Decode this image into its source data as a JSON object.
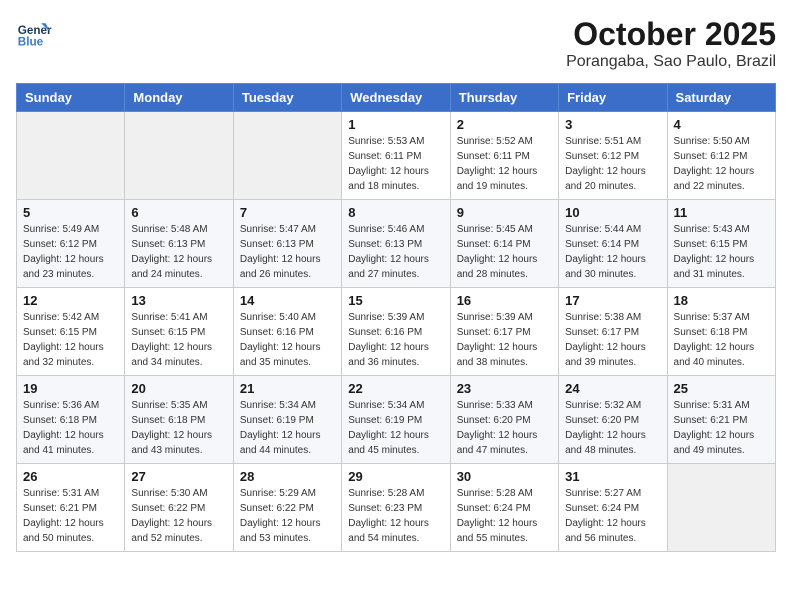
{
  "logo": {
    "line1": "General",
    "line2": "Blue"
  },
  "title": "October 2025",
  "subtitle": "Porangaba, Sao Paulo, Brazil",
  "days_of_week": [
    "Sunday",
    "Monday",
    "Tuesday",
    "Wednesday",
    "Thursday",
    "Friday",
    "Saturday"
  ],
  "weeks": [
    [
      {
        "num": "",
        "info": ""
      },
      {
        "num": "",
        "info": ""
      },
      {
        "num": "",
        "info": ""
      },
      {
        "num": "1",
        "info": "Sunrise: 5:53 AM\nSunset: 6:11 PM\nDaylight: 12 hours and 18 minutes."
      },
      {
        "num": "2",
        "info": "Sunrise: 5:52 AM\nSunset: 6:11 PM\nDaylight: 12 hours and 19 minutes."
      },
      {
        "num": "3",
        "info": "Sunrise: 5:51 AM\nSunset: 6:12 PM\nDaylight: 12 hours and 20 minutes."
      },
      {
        "num": "4",
        "info": "Sunrise: 5:50 AM\nSunset: 6:12 PM\nDaylight: 12 hours and 22 minutes."
      }
    ],
    [
      {
        "num": "5",
        "info": "Sunrise: 5:49 AM\nSunset: 6:12 PM\nDaylight: 12 hours and 23 minutes."
      },
      {
        "num": "6",
        "info": "Sunrise: 5:48 AM\nSunset: 6:13 PM\nDaylight: 12 hours and 24 minutes."
      },
      {
        "num": "7",
        "info": "Sunrise: 5:47 AM\nSunset: 6:13 PM\nDaylight: 12 hours and 26 minutes."
      },
      {
        "num": "8",
        "info": "Sunrise: 5:46 AM\nSunset: 6:13 PM\nDaylight: 12 hours and 27 minutes."
      },
      {
        "num": "9",
        "info": "Sunrise: 5:45 AM\nSunset: 6:14 PM\nDaylight: 12 hours and 28 minutes."
      },
      {
        "num": "10",
        "info": "Sunrise: 5:44 AM\nSunset: 6:14 PM\nDaylight: 12 hours and 30 minutes."
      },
      {
        "num": "11",
        "info": "Sunrise: 5:43 AM\nSunset: 6:15 PM\nDaylight: 12 hours and 31 minutes."
      }
    ],
    [
      {
        "num": "12",
        "info": "Sunrise: 5:42 AM\nSunset: 6:15 PM\nDaylight: 12 hours and 32 minutes."
      },
      {
        "num": "13",
        "info": "Sunrise: 5:41 AM\nSunset: 6:15 PM\nDaylight: 12 hours and 34 minutes."
      },
      {
        "num": "14",
        "info": "Sunrise: 5:40 AM\nSunset: 6:16 PM\nDaylight: 12 hours and 35 minutes."
      },
      {
        "num": "15",
        "info": "Sunrise: 5:39 AM\nSunset: 6:16 PM\nDaylight: 12 hours and 36 minutes."
      },
      {
        "num": "16",
        "info": "Sunrise: 5:39 AM\nSunset: 6:17 PM\nDaylight: 12 hours and 38 minutes."
      },
      {
        "num": "17",
        "info": "Sunrise: 5:38 AM\nSunset: 6:17 PM\nDaylight: 12 hours and 39 minutes."
      },
      {
        "num": "18",
        "info": "Sunrise: 5:37 AM\nSunset: 6:18 PM\nDaylight: 12 hours and 40 minutes."
      }
    ],
    [
      {
        "num": "19",
        "info": "Sunrise: 5:36 AM\nSunset: 6:18 PM\nDaylight: 12 hours and 41 minutes."
      },
      {
        "num": "20",
        "info": "Sunrise: 5:35 AM\nSunset: 6:18 PM\nDaylight: 12 hours and 43 minutes."
      },
      {
        "num": "21",
        "info": "Sunrise: 5:34 AM\nSunset: 6:19 PM\nDaylight: 12 hours and 44 minutes."
      },
      {
        "num": "22",
        "info": "Sunrise: 5:34 AM\nSunset: 6:19 PM\nDaylight: 12 hours and 45 minutes."
      },
      {
        "num": "23",
        "info": "Sunrise: 5:33 AM\nSunset: 6:20 PM\nDaylight: 12 hours and 47 minutes."
      },
      {
        "num": "24",
        "info": "Sunrise: 5:32 AM\nSunset: 6:20 PM\nDaylight: 12 hours and 48 minutes."
      },
      {
        "num": "25",
        "info": "Sunrise: 5:31 AM\nSunset: 6:21 PM\nDaylight: 12 hours and 49 minutes."
      }
    ],
    [
      {
        "num": "26",
        "info": "Sunrise: 5:31 AM\nSunset: 6:21 PM\nDaylight: 12 hours and 50 minutes."
      },
      {
        "num": "27",
        "info": "Sunrise: 5:30 AM\nSunset: 6:22 PM\nDaylight: 12 hours and 52 minutes."
      },
      {
        "num": "28",
        "info": "Sunrise: 5:29 AM\nSunset: 6:22 PM\nDaylight: 12 hours and 53 minutes."
      },
      {
        "num": "29",
        "info": "Sunrise: 5:28 AM\nSunset: 6:23 PM\nDaylight: 12 hours and 54 minutes."
      },
      {
        "num": "30",
        "info": "Sunrise: 5:28 AM\nSunset: 6:24 PM\nDaylight: 12 hours and 55 minutes."
      },
      {
        "num": "31",
        "info": "Sunrise: 5:27 AM\nSunset: 6:24 PM\nDaylight: 12 hours and 56 minutes."
      },
      {
        "num": "",
        "info": ""
      }
    ]
  ]
}
